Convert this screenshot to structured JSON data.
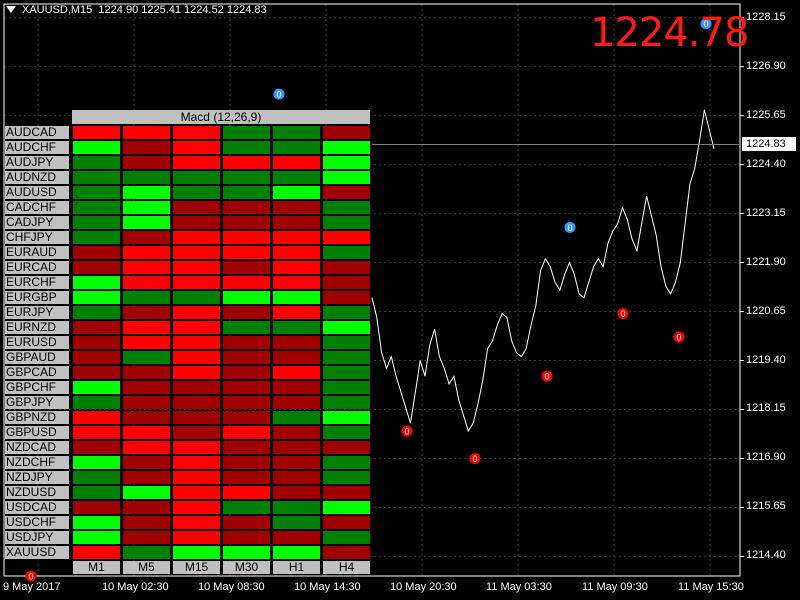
{
  "header": {
    "symbol": "XAUUSD,M15",
    "ohlc": "1224.90 1225.41 1224.52 1224.83"
  },
  "big_price": "1224.78",
  "current_price": "1224.83",
  "y_axis_labels": [
    "1228.15",
    "1226.90",
    "1225.65",
    "1224.40",
    "1223.15",
    "1221.90",
    "1220.65",
    "1219.40",
    "1218.15",
    "1216.90",
    "1215.65",
    "1214.40"
  ],
  "x_axis_labels": [
    "9 May 2017",
    "10 May 02:30",
    "10 May 08:30",
    "10 May 14:30",
    "10 May 20:30",
    "11 May 03:30",
    "11 May 09:30",
    "11 May 15:30"
  ],
  "macd_panel": {
    "title": "Macd (12,26,9)",
    "timeframes": [
      "M1",
      "M5",
      "M15",
      "M30",
      "H1",
      "H4"
    ],
    "pairs": [
      "AUDCAD",
      "AUDCHF",
      "AUDJPY",
      "AUDNZD",
      "AUDUSD",
      "CADCHF",
      "CADJPY",
      "CHFJPY",
      "EURAUD",
      "EURCAD",
      "EURCHF",
      "EURGBP",
      "EURJPY",
      "EURNZD",
      "EURUSD",
      "GBPAUD",
      "GBPCAD",
      "GBPCHF",
      "GBPJPY",
      "GBPNZD",
      "GBPUSD",
      "NZDCAD",
      "NZDCHF",
      "NZDJPY",
      "NZDUSD",
      "USDCAD",
      "USDCHF",
      "USDJPY",
      "XAUUSD"
    ],
    "cells": [
      [
        "br",
        "br",
        "br",
        "dg",
        "dg",
        "dr"
      ],
      [
        "bg",
        "dr",
        "br",
        "dg",
        "dg",
        "bg"
      ],
      [
        "dg",
        "dr",
        "br",
        "br",
        "br",
        "bg"
      ],
      [
        "dg",
        "dg",
        "dg",
        "dg",
        "dg",
        "bg"
      ],
      [
        "dg",
        "bg",
        "dg",
        "dg",
        "bg",
        "dr"
      ],
      [
        "dg",
        "bg",
        "dr",
        "dr",
        "dr",
        "dg"
      ],
      [
        "dg",
        "bg",
        "dr",
        "dr",
        "dr",
        "dg"
      ],
      [
        "dg",
        "dr",
        "br",
        "br",
        "br",
        "br"
      ],
      [
        "dr",
        "br",
        "br",
        "br",
        "br",
        "dg"
      ],
      [
        "dr",
        "br",
        "br",
        "dr",
        "br",
        "dr"
      ],
      [
        "bg",
        "br",
        "br",
        "br",
        "br",
        "dr"
      ],
      [
        "bg",
        "dg",
        "dg",
        "bg",
        "bg",
        "dr"
      ],
      [
        "dg",
        "dr",
        "br",
        "dr",
        "br",
        "dg"
      ],
      [
        "dr",
        "br",
        "br",
        "dg",
        "dg",
        "bg"
      ],
      [
        "dr",
        "br",
        "br",
        "dr",
        "dr",
        "dg"
      ],
      [
        "dr",
        "dg",
        "br",
        "dr",
        "dr",
        "dg"
      ],
      [
        "dr",
        "dr",
        "br",
        "dr",
        "br",
        "dg"
      ],
      [
        "bg",
        "dr",
        "dr",
        "dr",
        "dr",
        "dg"
      ],
      [
        "dg",
        "dr",
        "dr",
        "dr",
        "dr",
        "dg"
      ],
      [
        "br",
        "dr",
        "dr",
        "dr",
        "dg",
        "bg"
      ],
      [
        "br",
        "br",
        "dr",
        "br",
        "dr",
        "dg"
      ],
      [
        "dr",
        "br",
        "br",
        "dr",
        "dr",
        "dr"
      ],
      [
        "bg",
        "dr",
        "br",
        "dr",
        "dr",
        "dg"
      ],
      [
        "dg",
        "dr",
        "br",
        "dr",
        "dr",
        "dg"
      ],
      [
        "dg",
        "bg",
        "br",
        "br",
        "dr",
        "dr"
      ],
      [
        "dr",
        "dr",
        "br",
        "dg",
        "dg",
        "bg"
      ],
      [
        "bg",
        "dr",
        "br",
        "dr",
        "dg",
        "dr"
      ],
      [
        "bg",
        "dr",
        "br",
        "dr",
        "dr",
        "dg"
      ],
      [
        "br",
        "dg",
        "bg",
        "bg",
        "bg",
        "dr"
      ]
    ],
    "colors": {
      "bg": "#00ff00",
      "dg": "#008000",
      "br": "#ff0000",
      "dr": "#a00000"
    }
  },
  "markers": [
    {
      "label": "0",
      "color": "#3399ff",
      "time_label": "10 May 14:30 (approx)",
      "price": 1226.2
    },
    {
      "label": "0",
      "color": "#3399ff",
      "time_label": "11 May 03:30 (approx)",
      "price": 1222.8
    },
    {
      "label": "0",
      "color": "#3399ff",
      "time_label": "11 May 15:30 (approx)",
      "price": 1228.0
    },
    {
      "label": "0",
      "color": "#ff0000",
      "time_label": "9 May 2017 (approx)",
      "price": 1213.9
    },
    {
      "label": "0",
      "color": "#ff0000",
      "time_label": "10 May 20:30 (approx)",
      "price": 1217.6
    },
    {
      "label": "0",
      "color": "#ff0000",
      "time_label": "10 May 20:30 (approx)",
      "price": 1216.9
    },
    {
      "label": "0",
      "color": "#ff0000",
      "time_label": "11 May 03:30 (approx)",
      "price": 1219.0
    },
    {
      "label": "0",
      "color": "#ff0000",
      "time_label": "11 May 09:30 (approx)",
      "price": 1220.6
    },
    {
      "label": "0",
      "color": "#ff0000",
      "time_label": "11 May 09:30 (approx)",
      "price": 1220.0
    }
  ],
  "chart_data": {
    "type": "line",
    "series": [
      {
        "values": [
          1221.0,
          1220.5,
          1219.6,
          1219.2,
          1219.5,
          1219.0,
          1218.6,
          1218.2,
          1217.8,
          1218.6,
          1219.4,
          1219.0,
          1219.8,
          1220.2,
          1219.5,
          1219.2,
          1218.8,
          1219.0,
          1218.4,
          1218.0,
          1217.6,
          1217.8,
          1218.3,
          1218.9,
          1219.7,
          1219.9,
          1220.3,
          1220.6,
          1220.5,
          1219.9,
          1219.6,
          1219.5,
          1219.7,
          1220.3,
          1220.8,
          1221.7,
          1222.0,
          1221.8,
          1221.4,
          1221.2,
          1221.6,
          1221.9,
          1221.6,
          1221.1,
          1221.0,
          1221.4,
          1221.8,
          1222.0,
          1221.8,
          1222.4,
          1222.7,
          1222.9,
          1223.3,
          1223.0,
          1222.5,
          1222.2,
          1222.9,
          1223.6,
          1223.1,
          1222.6,
          1221.8,
          1221.3,
          1221.1,
          1221.4,
          1221.9,
          1222.9,
          1223.9,
          1224.3,
          1225.0,
          1225.8,
          1225.3,
          1224.8
        ]
      }
    ],
    "ylim": [
      1213.9,
      1228.5
    ],
    "x_range": [
      "9 May 2017",
      "11 May 15:30"
    ]
  }
}
